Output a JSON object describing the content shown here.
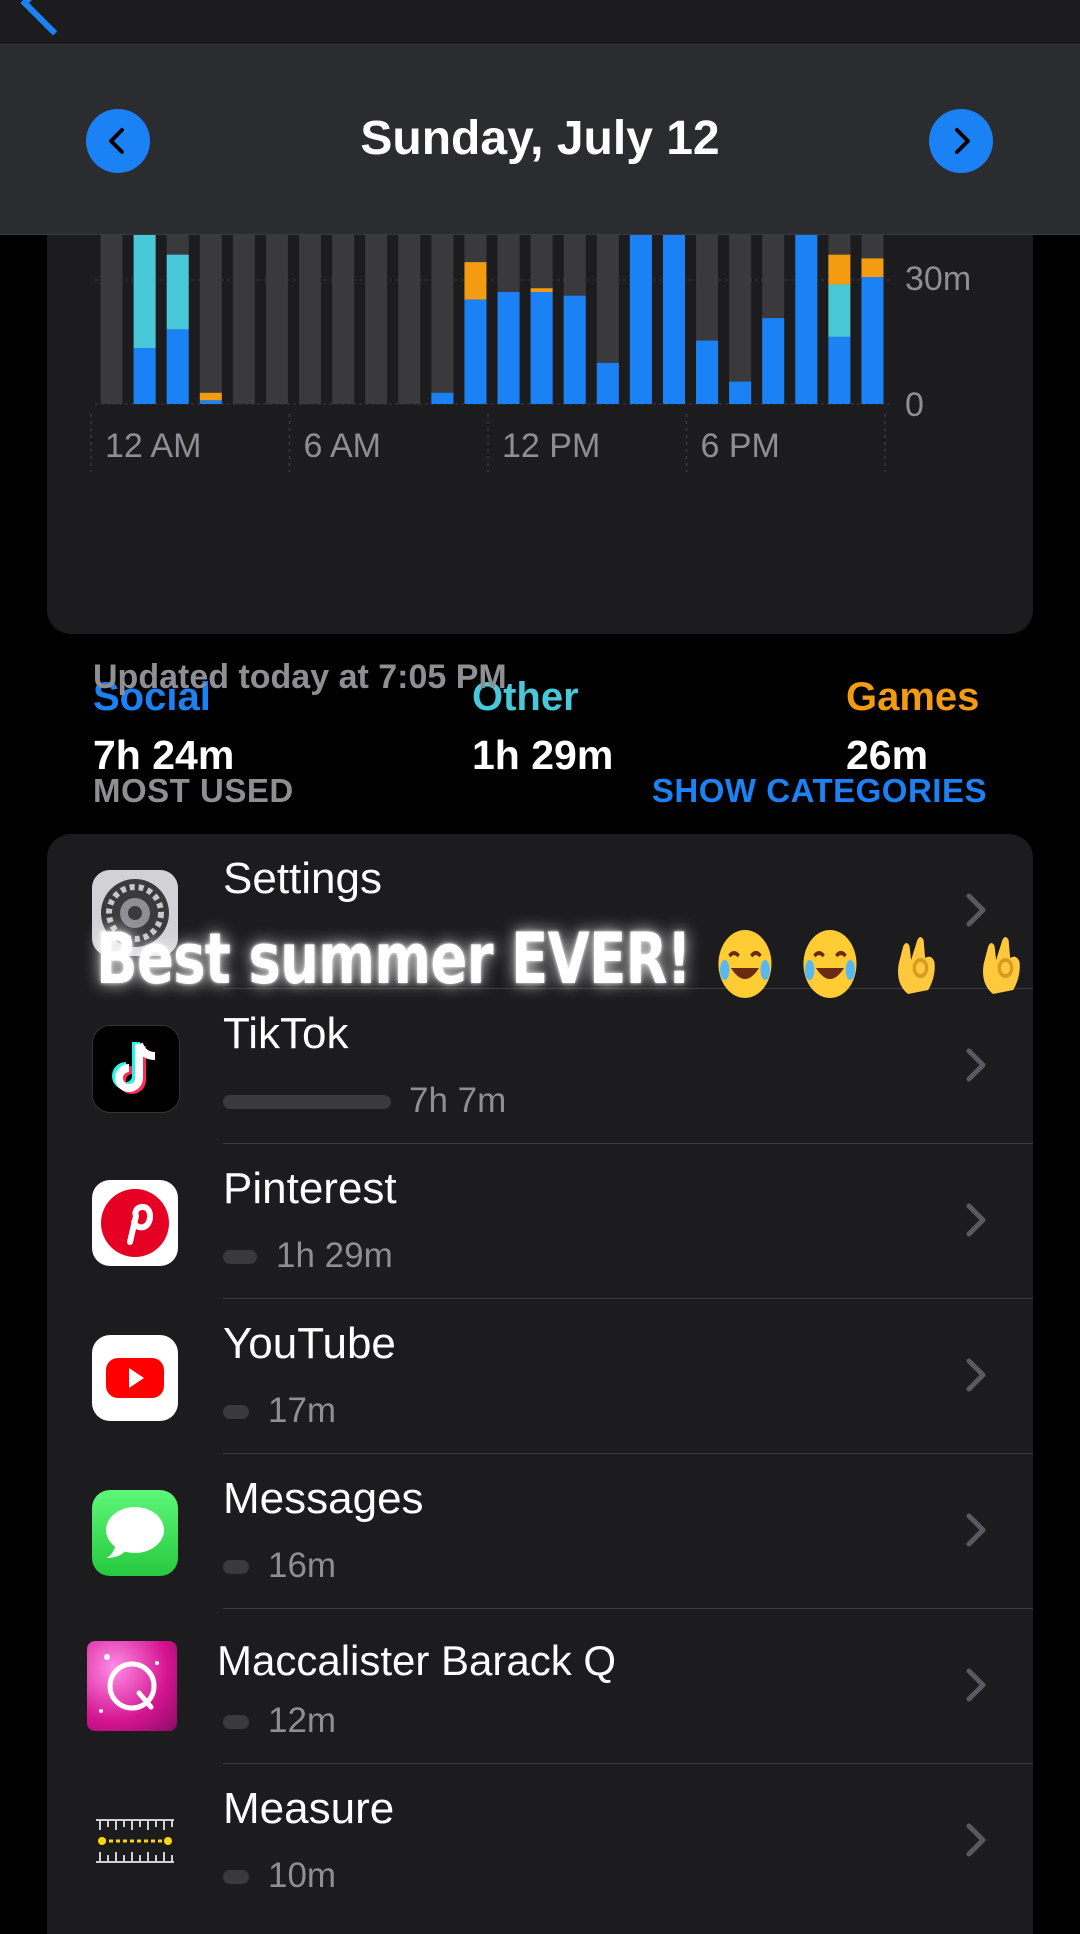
{
  "header": {
    "date": "Sunday, July 12"
  },
  "chart": {
    "y_labels": [
      "30m",
      "0"
    ],
    "x_labels": [
      "12 AM",
      "6 AM",
      "12 PM",
      "6 PM"
    ]
  },
  "chart_data": {
    "type": "bar",
    "categories": [
      "0",
      "1",
      "2",
      "3",
      "4",
      "5",
      "6",
      "7",
      "8",
      "9",
      "10",
      "11",
      "12",
      "13",
      "14",
      "15",
      "16",
      "17",
      "18",
      "19",
      "20",
      "21",
      "22",
      "23"
    ],
    "series": [
      {
        "name": "Social",
        "values": [
          0,
          15,
          20,
          1,
          0,
          0,
          0,
          0,
          0,
          0,
          3,
          28,
          30,
          30,
          29,
          11,
          50,
          50,
          17,
          6,
          23,
          50,
          18,
          34
        ]
      },
      {
        "name": "Other",
        "values": [
          0,
          50,
          20,
          0,
          0,
          0,
          0,
          0,
          0,
          0,
          0,
          0,
          0,
          0,
          0,
          0,
          0,
          0,
          0,
          0,
          0,
          0,
          14,
          0
        ]
      },
      {
        "name": "Games",
        "values": [
          0,
          0,
          0,
          2,
          0,
          0,
          0,
          0,
          0,
          0,
          0,
          10,
          0,
          1,
          0,
          0,
          0,
          0,
          0,
          0,
          0,
          0,
          8,
          5
        ]
      }
    ],
    "ylim": [
      0,
      60
    ]
  },
  "legend": [
    {
      "name": "Social",
      "value": "7h 24m",
      "color": "#1b82f5"
    },
    {
      "name": "Other",
      "value": "1h 29m",
      "color": "#48c8d8"
    },
    {
      "name": "Games",
      "value": "26m",
      "color": "#f39c12"
    }
  ],
  "updated": "Updated today at 7:05 PM",
  "most_used_label": "MOST USED",
  "show_categories_label": "SHOW CATEGORIES",
  "apps": [
    {
      "name": "Settings",
      "value": "",
      "icon": "settings-icon"
    },
    {
      "name": "TikTok",
      "value": "7h 7m",
      "icon": "tiktok-icon"
    },
    {
      "name": "Pinterest",
      "value": "1h 29m",
      "icon": "pinterest-icon"
    },
    {
      "name": "YouTube",
      "value": "17m",
      "icon": "youtube-icon"
    },
    {
      "name": "Messages",
      "value": "16m",
      "icon": "messages-icon"
    },
    {
      "name": "Maccalister Barack Q",
      "value": "12m",
      "icon": "q-app-icon"
    },
    {
      "name": "Measure",
      "value": "10m",
      "icon": "measure-icon"
    }
  ],
  "caption": "Best summer EVER!"
}
